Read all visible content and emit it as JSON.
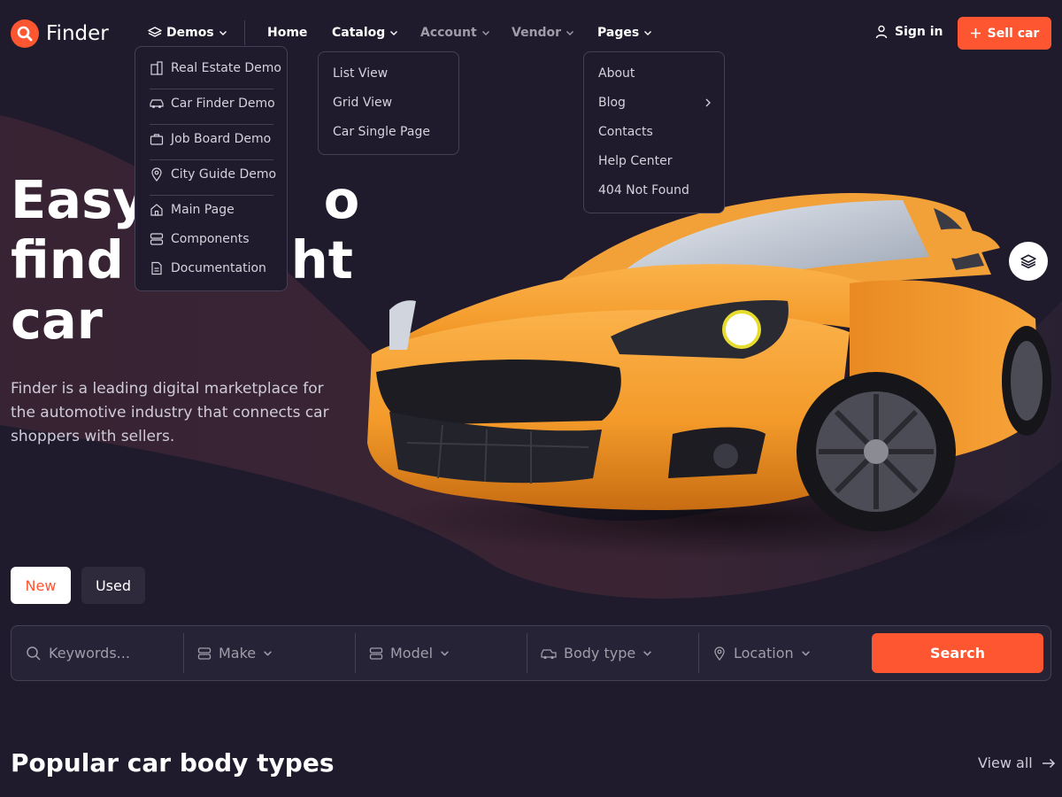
{
  "brand": {
    "name": "Finder",
    "accent": "#fd5631",
    "background": "#1f1b2d"
  },
  "nav": {
    "demos": "Demos",
    "home": "Home",
    "catalog": "Catalog",
    "account": "Account",
    "vendor": "Vendor",
    "pages": "Pages",
    "sign_in": "Sign in",
    "sell_car": "Sell car"
  },
  "demos_menu": {
    "items": [
      "Real Estate Demo",
      "Car Finder Demo",
      "Job Board Demo",
      "City Guide Demo",
      "Main Page",
      "Components",
      "Documentation"
    ],
    "icons": [
      "building-icon",
      "car-icon",
      "briefcase-icon",
      "map-pin-icon",
      "home-icon",
      "components-icon",
      "document-icon"
    ]
  },
  "catalog_menu": {
    "items": [
      "List View",
      "Grid View",
      "Car Single Page"
    ]
  },
  "pages_menu": {
    "items": [
      "About",
      "Blog",
      "Contacts",
      "Help Center",
      "404 Not Found"
    ]
  },
  "hero": {
    "title_line1": "Easy",
    "title_tail1": "o",
    "title_line2": "find t",
    "title_tail2": "ht",
    "title_line3": "car",
    "description": "Finder is a leading digital marketplace for the automotive industry that connects car shoppers with sellers."
  },
  "tabs": {
    "new": "New",
    "used": "Used"
  },
  "search": {
    "keywords_placeholder": "Keywords...",
    "make": "Make",
    "model": "Model",
    "body_type": "Body type",
    "location": "Location",
    "button": "Search"
  },
  "section": {
    "title": "Popular car body types",
    "view_all": "View all"
  }
}
